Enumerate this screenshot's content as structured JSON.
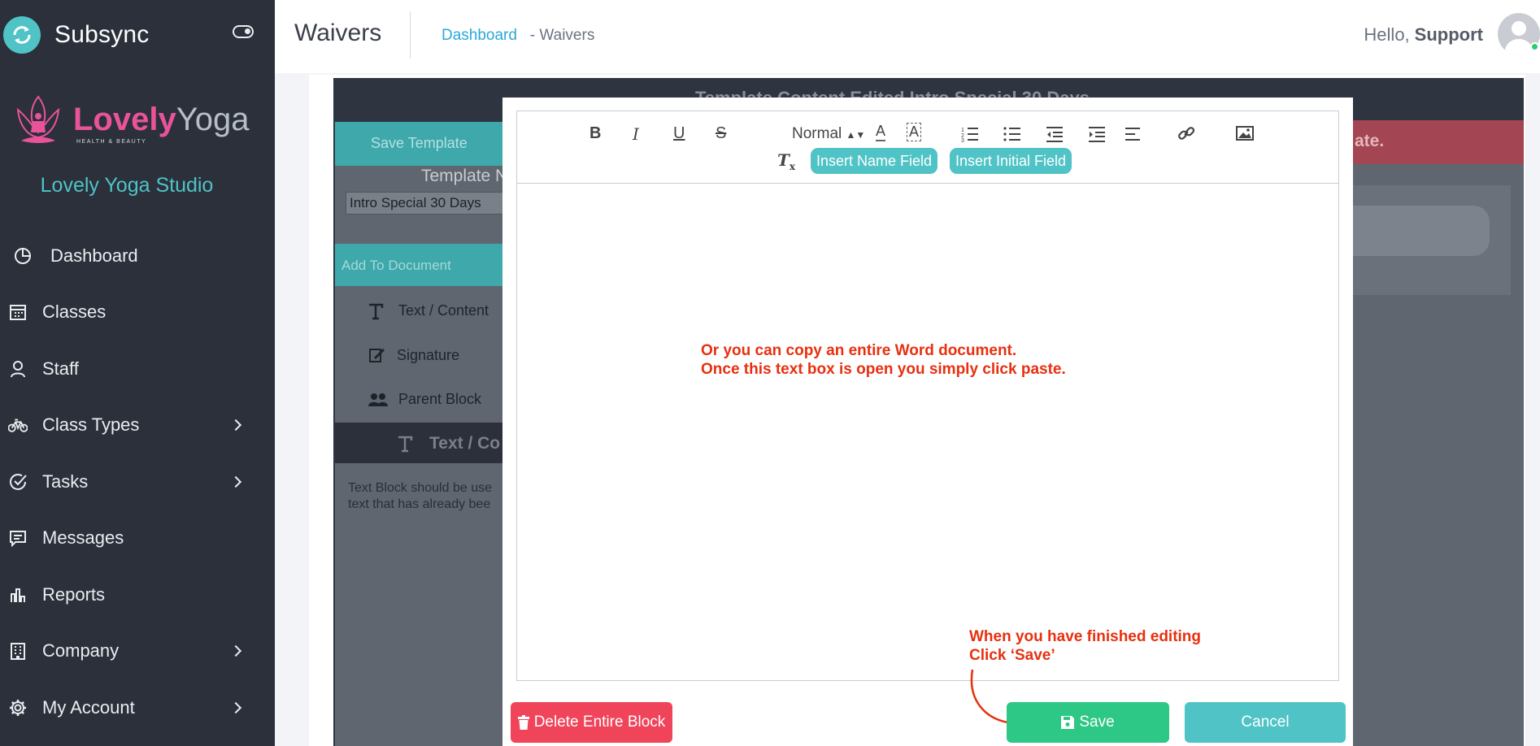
{
  "app": {
    "name": "Subsync"
  },
  "sidebar": {
    "logo": {
      "word1": "Lovely",
      "word2": "Yoga",
      "tagline": "HEALTH & BEAUTY"
    },
    "studio_name": "Lovely Yoga Studio",
    "items": [
      {
        "label": "Dashboard",
        "icon": "pie-chart-icon"
      },
      {
        "label": "Classes",
        "icon": "calendar-icon"
      },
      {
        "label": "Staff",
        "icon": "user-icon"
      },
      {
        "label": "Class Types",
        "icon": "bicycle-icon",
        "has_submenu": true
      },
      {
        "label": "Tasks",
        "icon": "check-circle-icon",
        "has_submenu": true
      },
      {
        "label": "Messages",
        "icon": "message-icon"
      },
      {
        "label": "Reports",
        "icon": "bar-chart-icon"
      },
      {
        "label": "Company",
        "icon": "building-icon",
        "has_submenu": true
      },
      {
        "label": "My Account",
        "icon": "gear-icon",
        "has_submenu": true
      }
    ]
  },
  "header": {
    "title": "Waivers",
    "breadcrumb": {
      "link": "Dashboard",
      "separator": "-",
      "current": "Waivers"
    },
    "greeting": "Hello,",
    "user": "Support"
  },
  "background": {
    "title": "Template Content Edited Intro Special 30 Days",
    "save_template": "Save Template",
    "alert_text": "ate.",
    "template_label": "Template N",
    "template_value": "Intro Special 30 Days",
    "add_to_document": "Add To Document",
    "items": [
      "Text / Content",
      "Signature",
      "Parent Block"
    ],
    "selected_block": "Text / Co",
    "description": "Text Block should be use text that has already bee"
  },
  "editor": {
    "format_select": "Normal",
    "insert_name": "Insert Name Field",
    "insert_initial": "Insert Initial Field"
  },
  "annotations": {
    "paste_note": "Or you can copy an entire Word document.",
    "paste_note_2": "Once this text box is open you simply click paste.",
    "save_note": "When you have finished editing",
    "save_note_2": "Click ‘Save’"
  },
  "modal_buttons": {
    "delete": "Delete Entire Block",
    "save": "Save",
    "cancel": "Cancel"
  },
  "colors": {
    "sidebar_bg": "#2b303b",
    "accent": "#4fc3c6",
    "link": "#2aa8d8",
    "danger": "#f0445a",
    "success": "#2dc885",
    "annotation": "#e8300f"
  }
}
